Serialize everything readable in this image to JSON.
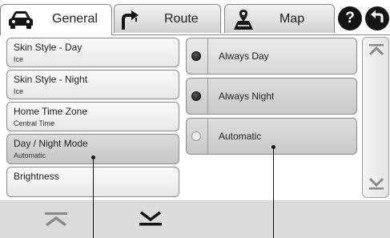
{
  "tabs": [
    {
      "label": "General",
      "icon": "car-icon",
      "active": true
    },
    {
      "label": "Route",
      "icon": "turn-arrow-icon",
      "active": false
    },
    {
      "label": "Map",
      "icon": "map-icon",
      "active": false
    }
  ],
  "header_buttons": {
    "help_label": "?",
    "back_icon": "back-arrow-icon"
  },
  "settings": [
    {
      "name": "Skin Style - Day",
      "value": "Ice"
    },
    {
      "name": "Skin Style - Night",
      "value": "Ice"
    },
    {
      "name": "Home Time Zone",
      "value": "Central Time"
    },
    {
      "name": "Day / Night Mode",
      "value": "Automatic",
      "selected": true
    },
    {
      "name": "Brightness",
      "value": ""
    }
  ],
  "options": [
    {
      "label": "Always Day",
      "checked": true
    },
    {
      "label": "Always Night",
      "checked": true
    },
    {
      "label": "Automatic",
      "checked": false
    }
  ],
  "scrollbar": {
    "up_icon": "scroll-up-icon",
    "down_icon": "scroll-down-icon"
  },
  "bottom_buttons": {
    "up_icon": "page-up-icon",
    "down_icon": "page-down-icon"
  },
  "colors": {
    "dark": "#141414",
    "panel": "#dcdcdc",
    "border": "#8a8a8a"
  }
}
